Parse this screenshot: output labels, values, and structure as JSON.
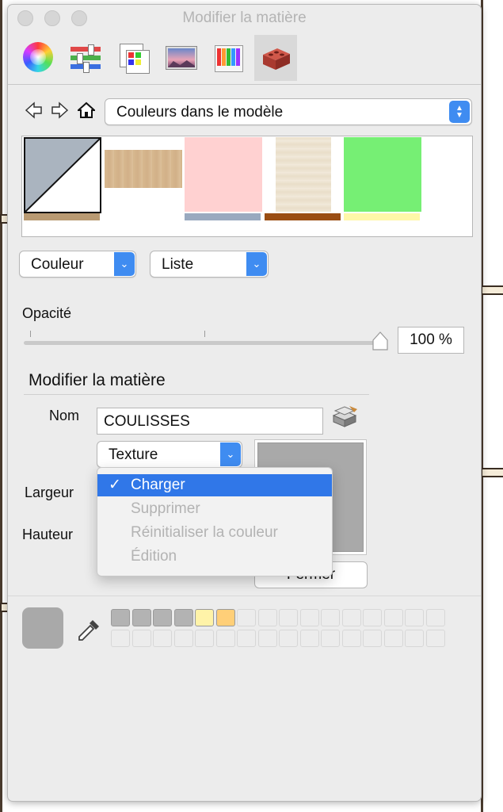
{
  "window": {
    "title": "Modifier la matière"
  },
  "toolbar": {
    "icons": [
      "color-wheel-icon",
      "sliders-icon",
      "color-palette-icon",
      "landscape-image-icon",
      "pencils-icon",
      "brick-icon"
    ]
  },
  "browser": {
    "collection": "Couleurs dans le modèle"
  },
  "swatches": [
    {
      "name": "default-material",
      "color": "#aab4bf"
    },
    {
      "name": "wood",
      "color": "#d2b48c"
    },
    {
      "name": "pink",
      "color": "#ffd1d1"
    },
    {
      "name": "light-wood",
      "color": "#e8dcc7"
    },
    {
      "name": "green",
      "color": "#76ef74"
    }
  ],
  "view_controls": {
    "type_label": "Couleur",
    "display_label": "Liste"
  },
  "opacity": {
    "label": "Opacité",
    "value_text": "100 %",
    "value": 100
  },
  "edit": {
    "title": "Modifier la matière",
    "name_label": "Nom",
    "name_value": "COULISSES",
    "texture_label": "Texture",
    "width_label": "Largeur",
    "height_label": "Hauteur",
    "close_label": "Fermer"
  },
  "texture_menu": {
    "items": [
      {
        "label": "Charger",
        "checked": true,
        "enabled": true
      },
      {
        "label": "Supprimer",
        "enabled": false
      },
      {
        "label": "Réinitialiser la couleur",
        "enabled": false
      },
      {
        "label": "Édition",
        "enabled": false
      }
    ]
  },
  "palette": {
    "current_color": "#a9a9a9",
    "row1": [
      "#b3b3b3",
      "#b3b3b3",
      "#b3b3b3",
      "#b3b3b3",
      "#fff3a8",
      "#ffcf78",
      "",
      "",
      "",
      "",
      "",
      "",
      "",
      "",
      "",
      ""
    ],
    "row2": [
      "",
      "",
      "",
      "",
      "",
      "",
      "",
      "",
      "",
      "",
      "",
      "",
      "",
      "",
      "",
      ""
    ]
  }
}
